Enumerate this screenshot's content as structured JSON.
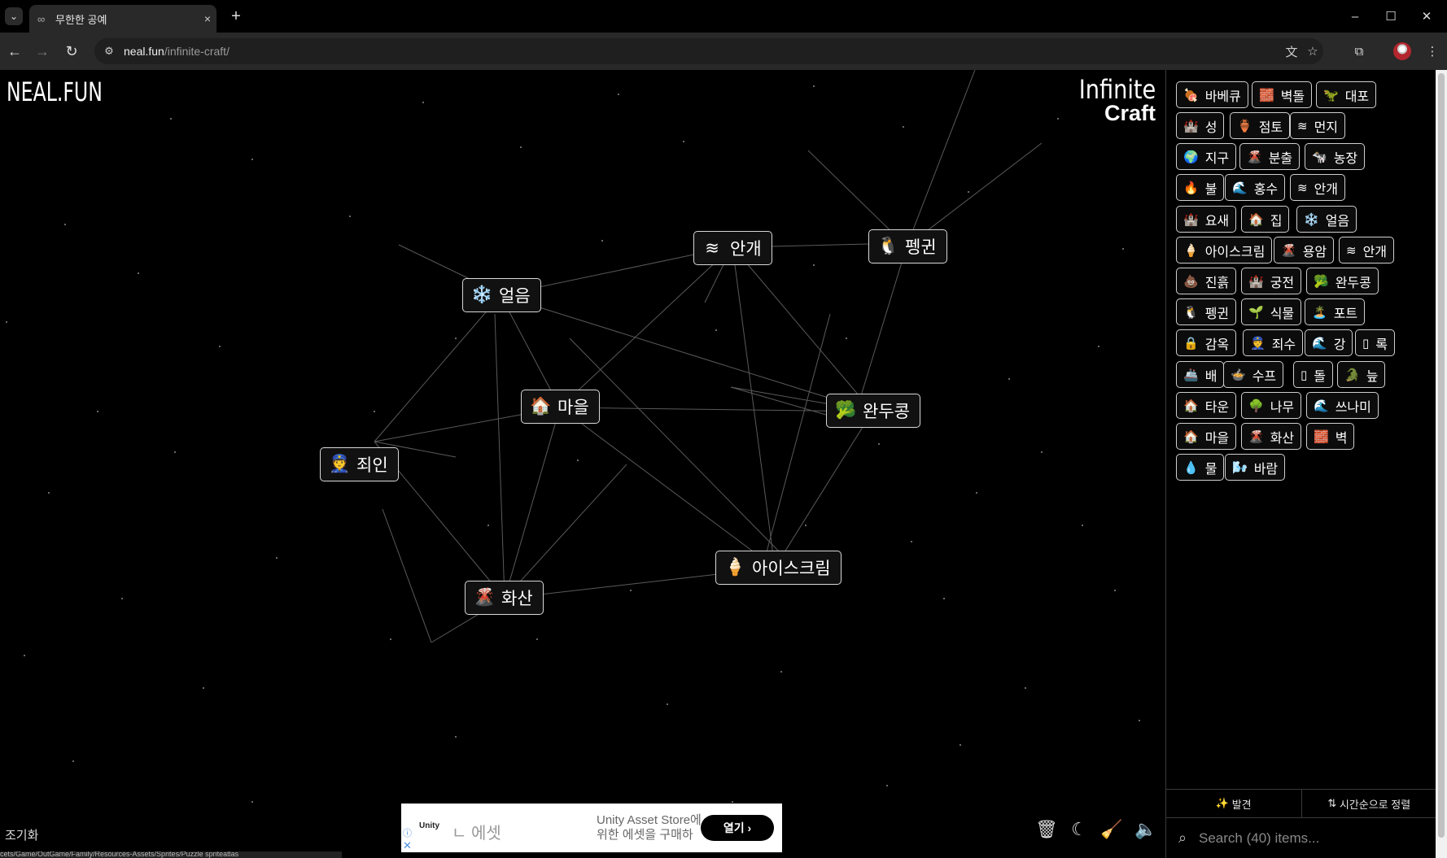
{
  "browser": {
    "tab_title": "무한한 공예",
    "tab_favicon": "∞",
    "tab_close": "×",
    "new_tab": "+",
    "url_host": "neal.fun",
    "url_path": "/infinite-craft/",
    "window_controls": {
      "minimize": "–",
      "maximize": "☐",
      "close": "✕"
    }
  },
  "logos": {
    "neal": "NEAL.FUN",
    "infinite": "Infinite",
    "craft": "Craft"
  },
  "canvas_items": [
    {
      "emoji": "≋",
      "label": "안개"
    },
    {
      "emoji": "🐧",
      "label": "펭귄"
    },
    {
      "emoji": "❄️",
      "label": "얼음"
    },
    {
      "emoji": "🏠",
      "label": "마을"
    },
    {
      "emoji": "🥦",
      "label": "완두콩"
    },
    {
      "emoji": "👮",
      "label": "죄인"
    },
    {
      "emoji": "🍦",
      "label": "아이스크림"
    },
    {
      "emoji": "🌋",
      "label": "화산"
    }
  ],
  "sidebar_items": [
    {
      "emoji": "🍖",
      "label": "바베큐"
    },
    {
      "emoji": "🧱",
      "label": "벽돌"
    },
    {
      "emoji": "🦖",
      "label": "대포"
    },
    {
      "emoji": "🏰",
      "label": "성"
    },
    {
      "emoji": "🏺",
      "label": "점토"
    },
    {
      "emoji": "≋",
      "label": "먼지"
    },
    {
      "emoji": "🌍",
      "label": "지구"
    },
    {
      "emoji": "🌋",
      "label": "분출"
    },
    {
      "emoji": "🐄",
      "label": "농장"
    },
    {
      "emoji": "🔥",
      "label": "불"
    },
    {
      "emoji": "🌊",
      "label": "홍수"
    },
    {
      "emoji": "≋",
      "label": "안개"
    },
    {
      "emoji": "🏰",
      "label": "요새"
    },
    {
      "emoji": "🏠",
      "label": "집"
    },
    {
      "emoji": "❄️",
      "label": "얼음"
    },
    {
      "emoji": "🍦",
      "label": "아이스크림"
    },
    {
      "emoji": "🌋",
      "label": "용암"
    },
    {
      "emoji": "≋",
      "label": "안개"
    },
    {
      "emoji": "💩",
      "label": "진흙"
    },
    {
      "emoji": "🏰",
      "label": "궁전"
    },
    {
      "emoji": "🥦",
      "label": "완두콩"
    },
    {
      "emoji": "🐧",
      "label": "펭귄"
    },
    {
      "emoji": "🌱",
      "label": "식물"
    },
    {
      "emoji": "🏝️",
      "label": "포트"
    },
    {
      "emoji": "🔒",
      "label": "감옥"
    },
    {
      "emoji": "👮",
      "label": "죄수"
    },
    {
      "emoji": "🌊",
      "label": "강"
    },
    {
      "emoji": "▯",
      "label": "록"
    },
    {
      "emoji": "🚢",
      "label": "배"
    },
    {
      "emoji": "🍲",
      "label": "수프"
    },
    {
      "emoji": "▯",
      "label": "돌"
    },
    {
      "emoji": "🐊",
      "label": "늪"
    },
    {
      "emoji": "🏠",
      "label": "타운"
    },
    {
      "emoji": "🌳",
      "label": "나무"
    },
    {
      "emoji": "🌊",
      "label": "쓰나미"
    },
    {
      "emoji": "🏠",
      "label": "마을"
    },
    {
      "emoji": "🌋",
      "label": "화산"
    },
    {
      "emoji": "🧱",
      "label": "벽"
    },
    {
      "emoji": "💧",
      "label": "물"
    },
    {
      "emoji": "🌬️",
      "label": "바람"
    }
  ],
  "sidebar_controls": {
    "discover": "발견",
    "sort": "시간순으로 정렬",
    "search_placeholder": "Search (40) items..."
  },
  "reset_label": "조기화",
  "ad": {
    "brand": "Unity",
    "cut_text": "ㄴ 에셋",
    "store_line1": "Unity Asset Store에",
    "store_line2": "위한 에셋을 구매하",
    "cta": "열기",
    "info": "ⓘ",
    "close": "✕"
  },
  "status_url": "cets/Game/OutGame/Family/Resources-Assets/Sprites/Puzzle spriteatlas"
}
